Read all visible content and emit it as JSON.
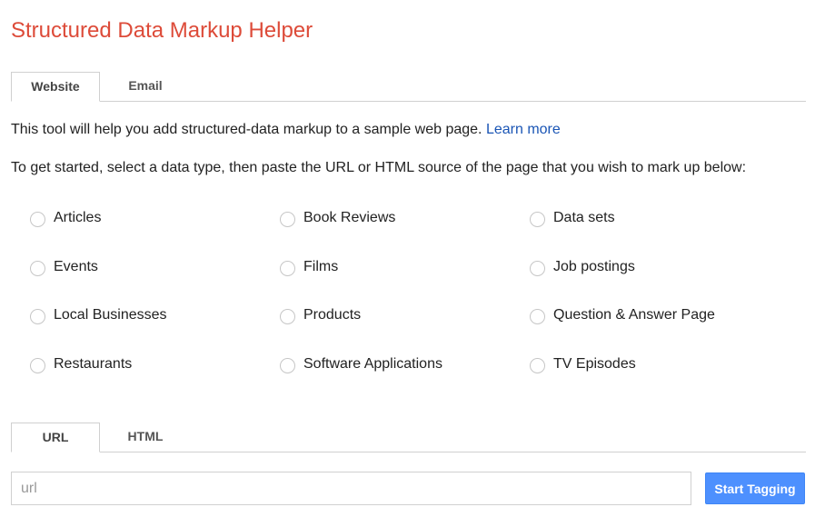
{
  "header": {
    "title": "Structured Data Markup Helper"
  },
  "top_tabs": [
    {
      "label": "Website",
      "active": true
    },
    {
      "label": "Email",
      "active": false
    }
  ],
  "intro": {
    "text": "This tool will help you add structured-data markup to a sample web page. ",
    "link": "Learn more"
  },
  "instructions": "To get started, select a data type, then paste the URL or HTML source of the page that you wish to mark up below:",
  "data_types": [
    {
      "label": "Articles",
      "selected": false
    },
    {
      "label": "Book Reviews",
      "selected": false
    },
    {
      "label": "Data sets",
      "selected": false
    },
    {
      "label": "Events",
      "selected": false
    },
    {
      "label": "Films",
      "selected": false
    },
    {
      "label": "Job postings",
      "selected": false
    },
    {
      "label": "Local Businesses",
      "selected": false
    },
    {
      "label": "Products",
      "selected": false
    },
    {
      "label": "Question & Answer Page",
      "selected": false
    },
    {
      "label": "Restaurants",
      "selected": false
    },
    {
      "label": "Software Applications",
      "selected": false
    },
    {
      "label": "TV Episodes",
      "selected": false
    }
  ],
  "source_tabs": [
    {
      "label": "URL",
      "active": true
    },
    {
      "label": "HTML",
      "active": false
    }
  ],
  "url_input": {
    "value": "",
    "placeholder": "url"
  },
  "start_button": {
    "label": "Start Tagging"
  },
  "colors": {
    "title": "#dd4b39",
    "link": "#1a55b5",
    "button": "#4d90fe"
  }
}
